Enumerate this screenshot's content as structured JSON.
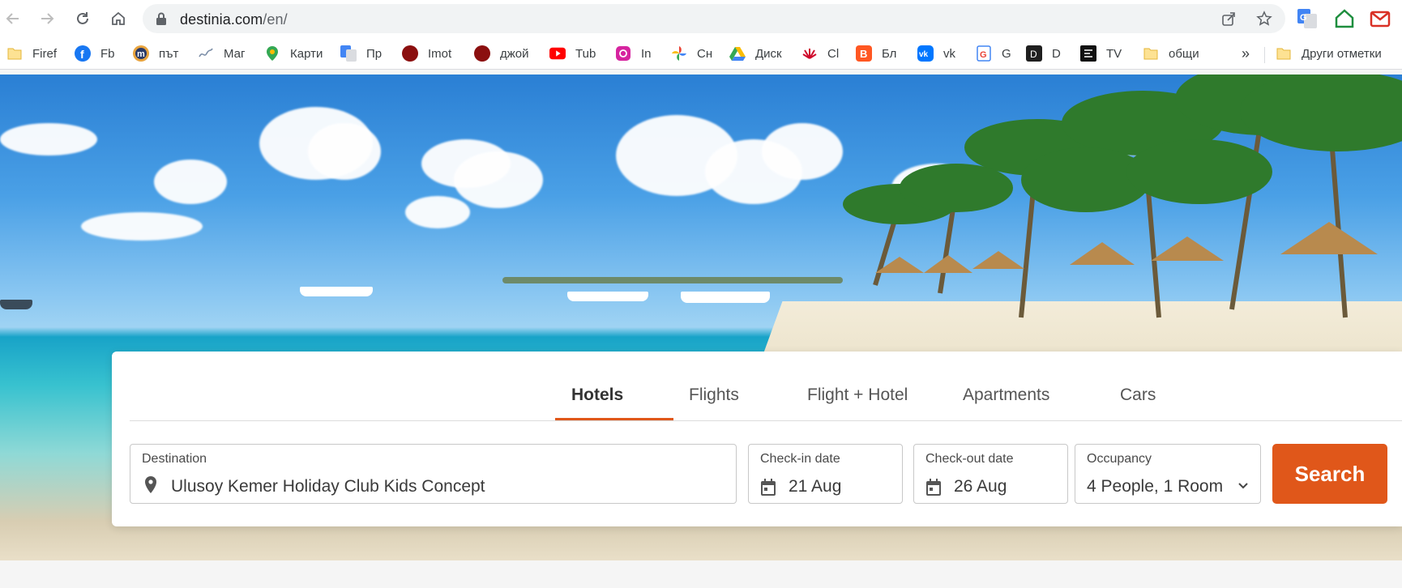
{
  "browser": {
    "url_host": "destinia.com",
    "url_path": "/en/"
  },
  "bookmarks": [
    {
      "label": "Firef",
      "icon": "folder-icon"
    },
    {
      "label": "Fb",
      "icon": "facebook-icon"
    },
    {
      "label": "път",
      "icon": "m-logo-icon"
    },
    {
      "label": "Маг",
      "icon": "wave-logo-icon"
    },
    {
      "label": "Карти",
      "icon": "google-maps-icon"
    },
    {
      "label": "Пр",
      "icon": "google-translate-icon"
    },
    {
      "label": "Imot",
      "icon": "red-circle-icon"
    },
    {
      "label": "джой",
      "icon": "red-circle-icon"
    },
    {
      "label": "Tub",
      "icon": "youtube-icon"
    },
    {
      "label": "In",
      "icon": "instagram-icon"
    },
    {
      "label": "Сн",
      "icon": "google-photos-icon"
    },
    {
      "label": "Диск",
      "icon": "google-drive-icon"
    },
    {
      "label": "Cl",
      "icon": "huawei-icon"
    },
    {
      "label": "Бл",
      "icon": "blogger-icon"
    },
    {
      "label": "vk",
      "icon": "vk-icon"
    },
    {
      "label": "G",
      "icon": "google-search-icon"
    },
    {
      "label": "D",
      "icon": "d-app-icon"
    },
    {
      "label": "TV",
      "icon": "tv-app-icon"
    },
    {
      "label": "общи",
      "icon": "folder-icon"
    }
  ],
  "bookmarks_overflow": "»",
  "other_bookmarks": "Други отметки",
  "tabs": [
    {
      "label": "Hotels",
      "active": true
    },
    {
      "label": "Flights",
      "active": false
    },
    {
      "label": "Flight + Hotel",
      "active": false
    },
    {
      "label": "Apartments",
      "active": false
    },
    {
      "label": "Cars",
      "active": false
    }
  ],
  "search": {
    "destination_label": "Destination",
    "destination_value": "Ulusoy Kemer Holiday Club  Kids Concept",
    "checkin_label": "Check-in date",
    "checkin_value": "21 Aug",
    "checkout_label": "Check-out date",
    "checkout_value": "26 Aug",
    "occupancy_label": "Occupancy",
    "occupancy_value": "4 People, 1 Room",
    "search_button": "Search"
  },
  "colors": {
    "accent": "#e0571a"
  }
}
